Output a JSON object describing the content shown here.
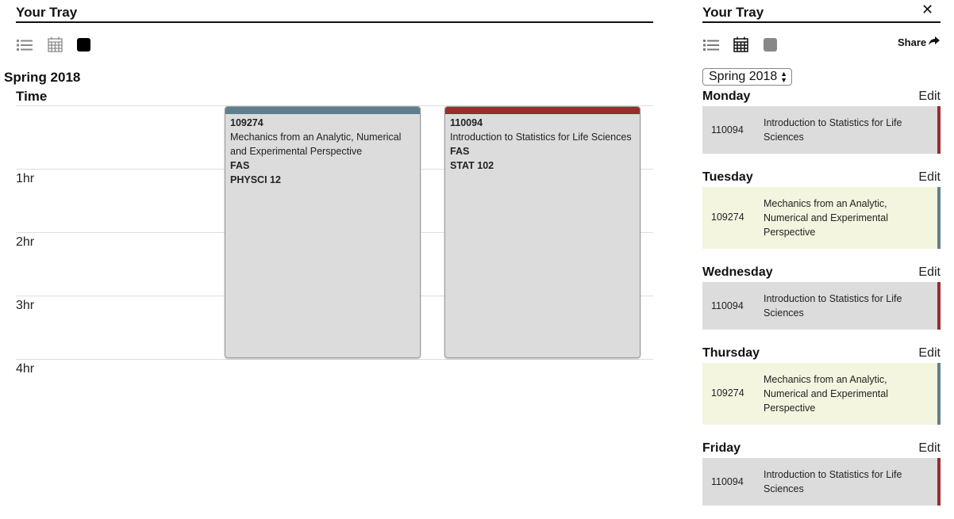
{
  "tray": {
    "title": "Your Tray",
    "term": "Spring 2018",
    "time_label": "Time",
    "hour_labels": [
      "1hr",
      "2hr",
      "3hr",
      "4hr"
    ]
  },
  "icons": {
    "list": "list-icon",
    "calendar": "calendar-icon",
    "square": "square-icon",
    "close": "close-icon",
    "share": "share-arrow-icon"
  },
  "courses": [
    {
      "number": "109274",
      "title": "Mechanics from an Analytic, Numerical and Experimental Perspective",
      "school": "FAS",
      "code": "PHYSCI 12",
      "color": "#5f7f8f"
    },
    {
      "number": "110094",
      "title": "Introduction to Statistics for Life Sciences",
      "school": "FAS",
      "code": "STAT 102",
      "color": "#9b2c2c"
    }
  ],
  "sidebar": {
    "title": "Your Tray",
    "share_label": "Share",
    "term_select": "Spring 2018",
    "edit_label": "Edit",
    "days": [
      {
        "day": "Monday",
        "course_number": "110094",
        "course_title": "Introduction to Statistics for Life Sciences",
        "bg": "#dcdcdc",
        "stripe": "#9b2c2c"
      },
      {
        "day": "Tuesday",
        "course_number": "109274",
        "course_title": "Mechanics from an Analytic, Numerical and Experimental Perspective",
        "bg": "#f4f5df",
        "stripe": "#5f7f8f"
      },
      {
        "day": "Wednesday",
        "course_number": "110094",
        "course_title": "Introduction to Statistics for Life Sciences",
        "bg": "#dcdcdc",
        "stripe": "#9b2c2c"
      },
      {
        "day": "Thursday",
        "course_number": "109274",
        "course_title": "Mechanics from an Analytic, Numerical and Experimental Perspective",
        "bg": "#f4f5df",
        "stripe": "#5f7f8f"
      },
      {
        "day": "Friday",
        "course_number": "110094",
        "course_title": "Introduction to Statistics for Life Sciences",
        "bg": "#dcdcdc",
        "stripe": "#9b2c2c"
      }
    ]
  }
}
